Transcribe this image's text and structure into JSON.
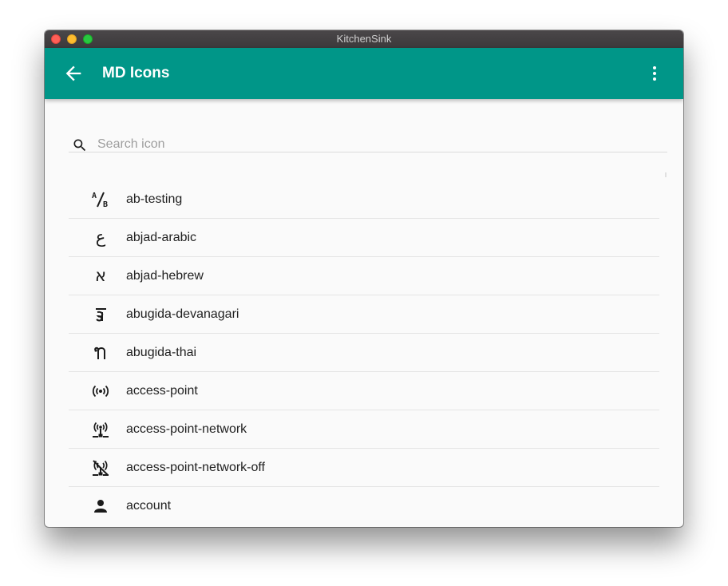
{
  "window": {
    "title": "KitchenSink"
  },
  "appbar": {
    "title": "MD Icons",
    "back_icon": "arrow-left-icon",
    "menu_icon": "dots-vertical-icon"
  },
  "search": {
    "placeholder": "Search icon",
    "value": "",
    "icon": "magnify-icon"
  },
  "colors": {
    "primary": "#009688",
    "background": "#fafafa",
    "icon": "#1a1a1a"
  },
  "icons": [
    {
      "label": "ab-testing",
      "icon": "ab-testing-icon"
    },
    {
      "label": "abjad-arabic",
      "icon": "abjad-arabic-icon",
      "glyph": "ع"
    },
    {
      "label": "abjad-hebrew",
      "icon": "abjad-hebrew-icon",
      "glyph": "א"
    },
    {
      "label": "abugida-devanagari",
      "icon": "abugida-devanagari-icon",
      "glyph": "ऱ"
    },
    {
      "label": "abugida-thai",
      "icon": "abugida-thai-icon",
      "glyph": "ท"
    },
    {
      "label": "access-point",
      "icon": "access-point-icon"
    },
    {
      "label": "access-point-network",
      "icon": "access-point-network-icon"
    },
    {
      "label": "access-point-network-off",
      "icon": "access-point-network-off-icon"
    },
    {
      "label": "account",
      "icon": "account-icon"
    }
  ]
}
